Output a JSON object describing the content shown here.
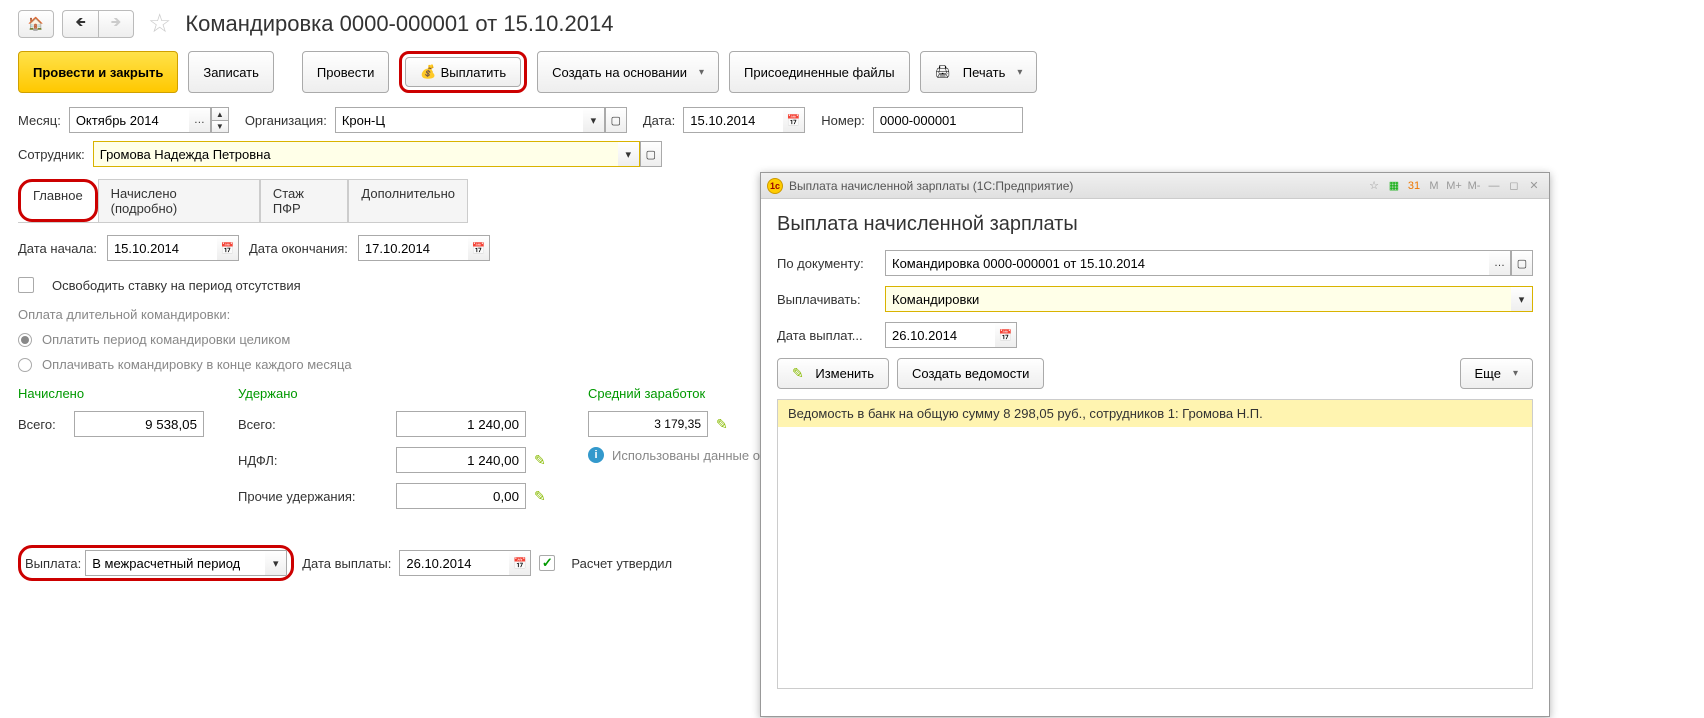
{
  "header": {
    "title": "Командировка 0000-000001 от 15.10.2014"
  },
  "toolbar": {
    "post_close": "Провести и закрыть",
    "save": "Записать",
    "post": "Провести",
    "pay": "Выплатить",
    "create_based": "Создать на основании",
    "attached_files": "Присоединенные файлы",
    "print": "Печать"
  },
  "fields": {
    "month_lbl": "Месяц:",
    "month_val": "Октябрь 2014",
    "org_lbl": "Организация:",
    "org_val": "Крон-Ц",
    "date_lbl": "Дата:",
    "date_val": "15.10.2014",
    "number_lbl": "Номер:",
    "number_val": "0000-000001",
    "employee_lbl": "Сотрудник:",
    "employee_val": "Громова Надежда Петровна"
  },
  "tabs": {
    "main": "Главное",
    "accrued": "Начислено (подробно)",
    "pfr": "Стаж ПФР",
    "extra": "Дополнительно"
  },
  "main": {
    "date_start_lbl": "Дата начала:",
    "date_start_val": "15.10.2014",
    "date_end_lbl": "Дата окончания:",
    "date_end_val": "17.10.2014",
    "free_rate": "Освободить ставку на период отсутствия",
    "long_trip_lbl": "Оплата длительной командировки:",
    "opt_full": "Оплатить период командировки целиком",
    "opt_monthly": "Оплачивать командировку в конце каждого месяца",
    "accrued_h": "Начислено",
    "withheld_h": "Удержано",
    "avg_h": "Средний заработок",
    "total_lbl": "Всего:",
    "accrued_total": "9 538,05",
    "withheld_total": "1 240,00",
    "ndfl_lbl": "НДФЛ:",
    "ndfl_val": "1 240,00",
    "other_lbl": "Прочие удержания:",
    "other_val": "0,00",
    "avg_val": "3 179,35",
    "avg_note": "Использованы данные о",
    "payment_lbl": "Выплата:",
    "payment_val": "В межрасчетный период",
    "paydate_lbl": "Дата выплаты:",
    "paydate_val": "26.10.2014",
    "approved_lbl": "Расчет утвердил"
  },
  "dialog": {
    "titlebar": "Выплата начисленной зарплаты  (1С:Предприятие)",
    "heading": "Выплата начисленной зарплаты",
    "doc_lbl": "По документу:",
    "doc_val": "Командировка 0000-000001 от 15.10.2014",
    "pay_lbl": "Выплачивать:",
    "pay_val": "Командировки",
    "paydate_lbl": "Дата выплат...",
    "paydate_val": "26.10.2014",
    "edit_btn": "Изменить",
    "create_btn": "Создать ведомости",
    "more_btn": "Еще",
    "list_row": "Ведомость в банк на общую сумму 8 298,05 руб., сотрудников 1: Громова Н.П."
  }
}
